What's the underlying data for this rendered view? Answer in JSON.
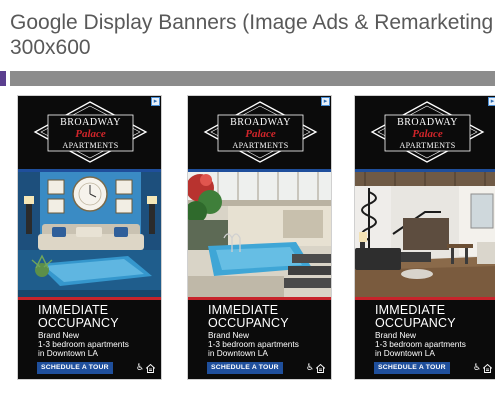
{
  "slide": {
    "title_line1": "Google Display Banners (Image Ads & Remarketing",
    "title_line2": "300x600"
  },
  "colors": {
    "title_text": "#595959",
    "divider": "#8c8c8c",
    "divider_accent": "#5b3f8f",
    "banner_background": "#0b0b0b",
    "brand_blue": "#1f4f9c",
    "brand_red": "#c8242b"
  },
  "banners": [
    {
      "logo": {
        "line1": "BROADWAY",
        "line2": "Palace",
        "line3": "APARTMENTS"
      },
      "photo": "living-room-with-blue-sofa",
      "headline": [
        "IMMEDIATE",
        "OCCUPANCY"
      ],
      "sub": [
        "Brand New",
        "1-3 bedroom apartments",
        "in Downtown LA"
      ],
      "cta": "SCHEDULE A TOUR",
      "icons": [
        "accessibility-icon",
        "equal-housing-icon",
        "adchoices-icon"
      ]
    },
    {
      "logo": {
        "line1": "BROADWAY",
        "line2": "Palace",
        "line3": "APARTMENTS"
      },
      "photo": "rooftop-pool-and-spa",
      "headline": [
        "IMMEDIATE",
        "OCCUPANCY"
      ],
      "sub": [
        "Brand New",
        "1-3 bedroom apartments",
        "in Downtown LA"
      ],
      "cta": "SCHEDULE A TOUR",
      "icons": [
        "accessibility-icon",
        "equal-housing-icon",
        "adchoices-icon"
      ]
    },
    {
      "logo": {
        "line1": "BROADWAY",
        "line2": "Palace",
        "line3": "APARTMENTS"
      },
      "photo": "loft-with-spiral-staircase",
      "headline": [
        "IMMEDIATE",
        "OCCUPANCY"
      ],
      "sub": [
        "Brand New",
        "1-3 bedroom apartments",
        "in Downtown LA"
      ],
      "cta": "SCHEDULE A TOUR",
      "icons": [
        "accessibility-icon",
        "equal-housing-icon",
        "adchoices-icon"
      ]
    }
  ]
}
